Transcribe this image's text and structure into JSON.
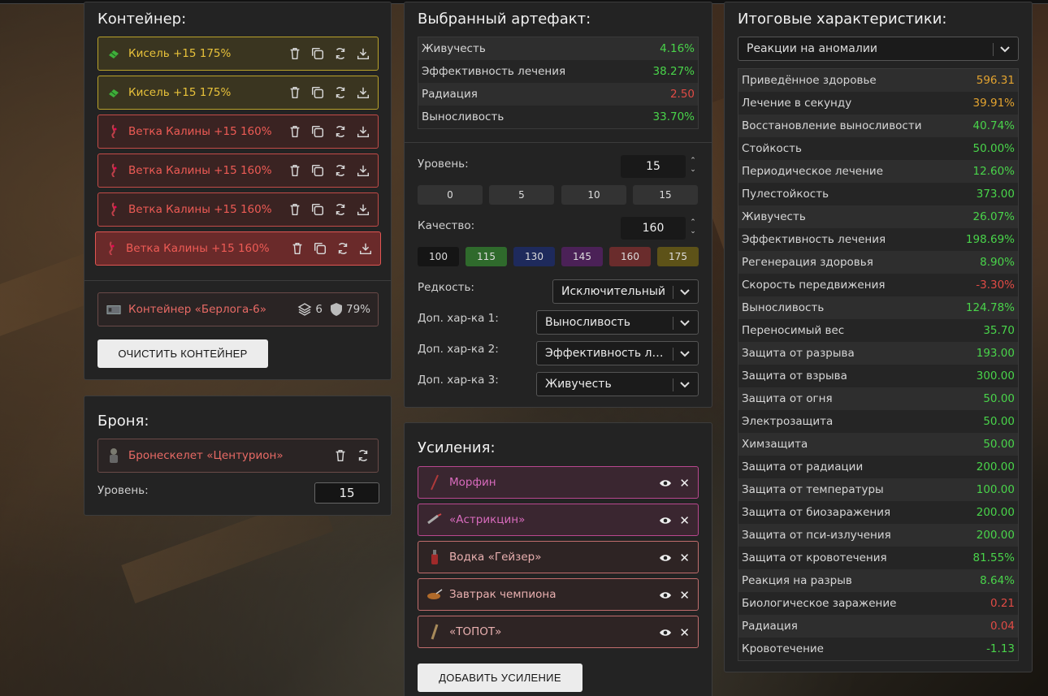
{
  "container": {
    "title": "Контейнер:",
    "items": [
      {
        "label": "Кисель +15 175%",
        "color": "yellow"
      },
      {
        "label": "Кисель +15 175%",
        "color": "yellow"
      },
      {
        "label": "Ветка Калины +15 160%",
        "color": "red"
      },
      {
        "label": "Ветка Калины +15 160%",
        "color": "red"
      },
      {
        "label": "Ветка Калины +15 160%",
        "color": "red"
      },
      {
        "label": "Ветка Калины +15 160%",
        "color": "red-selected"
      }
    ],
    "container_item": {
      "label": "Контейнер «Берлога-6»",
      "slots": "6",
      "protection": "79%"
    },
    "clear_button": "ОЧИСТИТЬ КОНТЕЙНЕР"
  },
  "armor": {
    "title": "Броня:",
    "item": "Бронескелет «Центурион»",
    "level_label": "Уровень:",
    "level_value": "15"
  },
  "artifact": {
    "title": "Выбранный артефакт:",
    "stats": [
      {
        "name": "Живучесть",
        "value": "4.16%",
        "color": "green"
      },
      {
        "name": "Эффективность лечения",
        "value": "38.27%",
        "color": "green"
      },
      {
        "name": "Радиация",
        "value": "2.50",
        "color": "red"
      },
      {
        "name": "Выносливость",
        "value": "33.70%",
        "color": "green"
      }
    ],
    "level_label": "Уровень:",
    "level_value": "15",
    "level_presets": [
      "0",
      "5",
      "10",
      "15"
    ],
    "quality_label": "Качество:",
    "quality_value": "160",
    "quality_presets": [
      {
        "label": "100",
        "bg": "#151515"
      },
      {
        "label": "115",
        "bg": "#2f6a2c"
      },
      {
        "label": "130",
        "bg": "#1e2a5c"
      },
      {
        "label": "145",
        "bg": "#4b2157"
      },
      {
        "label": "160",
        "bg": "#6a2c2c"
      },
      {
        "label": "175",
        "bg": "#5d5218"
      }
    ],
    "rarity_label": "Редкость:",
    "rarity_value": "Исключительный",
    "extra1_label": "Доп. хар-ка 1:",
    "extra1_value": "Выносливость",
    "extra2_label": "Доп. хар-ка 2:",
    "extra2_value": "Эффективность ле...",
    "extra3_label": "Доп. хар-ка 3:",
    "extra3_value": "Живучесть"
  },
  "boosts": {
    "title": "Усиления:",
    "items": [
      {
        "label": "Морфин",
        "style": "pink"
      },
      {
        "label": "«Астрикцин»",
        "style": "pink"
      },
      {
        "label": "Водка «Гейзер»",
        "style": "rose"
      },
      {
        "label": "Завтрак чемпиона",
        "style": "rose"
      },
      {
        "label": "«ТОПОТ»",
        "style": "rose"
      }
    ],
    "add_button": "ДОБАВИТЬ УСИЛЕНИЕ"
  },
  "totals": {
    "title": "Итоговые характеристики:",
    "filter_value": "Реакции на аномалии",
    "stats": [
      {
        "name": "Приведённое здоровье",
        "value": "596.31",
        "color": "orange"
      },
      {
        "name": "Лечение в секунду",
        "value": "39.91%",
        "color": "orange"
      },
      {
        "name": "Восстановление выносливости",
        "value": "40.74%",
        "color": "green"
      },
      {
        "name": "Стойкость",
        "value": "50.00%",
        "color": "green"
      },
      {
        "name": "Периодическое лечение",
        "value": "12.60%",
        "color": "green"
      },
      {
        "name": "Пулестойкость",
        "value": "373.00",
        "color": "green"
      },
      {
        "name": "Живучесть",
        "value": "26.07%",
        "color": "green"
      },
      {
        "name": "Эффективность лечения",
        "value": "198.69%",
        "color": "green"
      },
      {
        "name": "Регенерация здоровья",
        "value": "8.90%",
        "color": "green"
      },
      {
        "name": "Скорость передвижения",
        "value": "-3.30%",
        "color": "red"
      },
      {
        "name": "Выносливость",
        "value": "124.78%",
        "color": "green"
      },
      {
        "name": "Переносимый вес",
        "value": "35.70",
        "color": "green"
      },
      {
        "name": "Защита от разрыва",
        "value": "193.00",
        "color": "green"
      },
      {
        "name": "Защита от взрыва",
        "value": "300.00",
        "color": "green"
      },
      {
        "name": "Защита от огня",
        "value": "50.00",
        "color": "green"
      },
      {
        "name": "Электрозащита",
        "value": "50.00",
        "color": "green"
      },
      {
        "name": "Химзащита",
        "value": "50.00",
        "color": "green"
      },
      {
        "name": "Защита от радиации",
        "value": "200.00",
        "color": "green"
      },
      {
        "name": "Защита от температуры",
        "value": "100.00",
        "color": "green"
      },
      {
        "name": "Защита от биозаражения",
        "value": "200.00",
        "color": "green"
      },
      {
        "name": "Защита от пси-излучения",
        "value": "200.00",
        "color": "green"
      },
      {
        "name": "Защита от кровотечения",
        "value": "81.55%",
        "color": "green"
      },
      {
        "name": "Реакция на разрыв",
        "value": "8.64%",
        "color": "green"
      },
      {
        "name": "Биологическое заражение",
        "value": "0.21",
        "color": "red"
      },
      {
        "name": "Радиация",
        "value": "0.04",
        "color": "red"
      },
      {
        "name": "Кровотечение",
        "value": "-1.13",
        "color": "green"
      }
    ]
  }
}
